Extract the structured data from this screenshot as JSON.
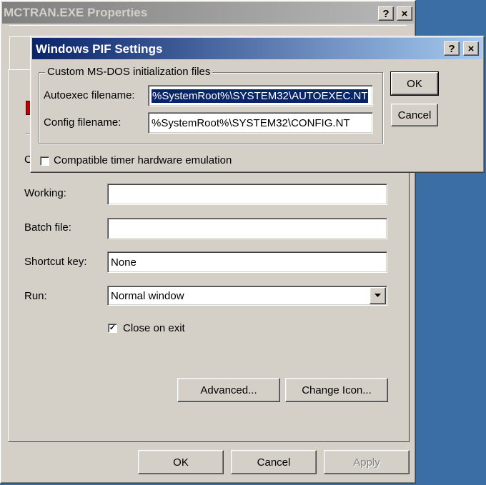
{
  "back_window": {
    "title": "MCTRAN.EXE Properties",
    "help_btn": "?",
    "close_btn": "×",
    "partial_label": "C",
    "fields": {
      "working_label": "Working:",
      "working_value": "",
      "batch_label": "Batch file:",
      "batch_value": "",
      "shortcut_label": "Shortcut key:",
      "shortcut_value": "None",
      "run_label": "Run:",
      "run_value": "Normal window"
    },
    "close_on_exit_label": "Close on exit",
    "close_on_exit_checked": true,
    "advanced_button": "Advanced...",
    "change_icon_button": "Change Icon...",
    "ok_button": "OK",
    "cancel_button": "Cancel",
    "apply_button": "Apply"
  },
  "front_dialog": {
    "title": "Windows PIF Settings",
    "help_btn": "?",
    "close_btn": "×",
    "group_label": "Custom MS-DOS initialization files",
    "autoexec_label": "Autoexec filename:",
    "autoexec_value": "%SystemRoot%\\SYSTEM32\\AUTOEXEC.NT",
    "config_label": "Config filename:",
    "config_value": "%SystemRoot%\\SYSTEM32\\CONFIG.NT",
    "timer_label": "Compatible timer hardware emulation",
    "timer_checked": false,
    "ok_button": "OK",
    "cancel_button": "Cancel"
  },
  "colors": {
    "desktop": "#3a6ea5",
    "dialog_face": "#d4d0c8",
    "active_title_start": "#0a246a",
    "active_title_end": "#a6caf0",
    "inactive_title": "#808080",
    "selection": "#0a246a"
  }
}
